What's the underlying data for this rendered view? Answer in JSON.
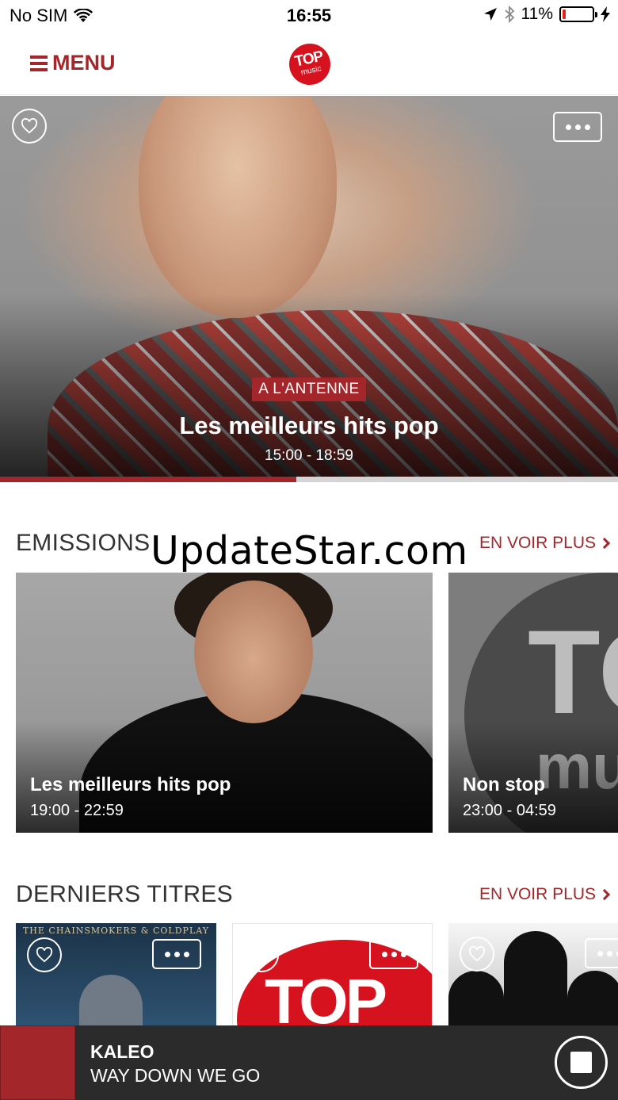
{
  "status_bar": {
    "carrier": "No SIM",
    "time": "16:55",
    "battery_percent": "11%",
    "battery_level": 0.11,
    "icons": [
      "wifi-icon",
      "location-arrow-icon",
      "bluetooth-icon",
      "battery-icon",
      "charging-bolt-icon"
    ]
  },
  "nav": {
    "menu_label": "MENU",
    "logo_line1": "TOP",
    "logo_line2": "music"
  },
  "hero": {
    "badge": "A L'ANTENNE",
    "title": "Les meilleurs hits pop",
    "time": "15:00 - 18:59",
    "progress": 0.48
  },
  "watermark": "UpdateStar.com",
  "emissions": {
    "title": "EMISSIONS",
    "see_more": "EN VOIR PLUS",
    "cards": [
      {
        "title": "Les meilleurs hits pop",
        "time": "19:00 - 22:59"
      },
      {
        "title": "Non stop",
        "time": "23:00 - 04:59",
        "art_text_1": "TO",
        "art_text_2": "mu"
      }
    ]
  },
  "derniers_titres": {
    "title": "DERNIERS TITRES",
    "see_more": "EN VOIR PLUS",
    "cards": [
      {
        "art_text": "THE CHAINSMOKERS & COLDPLAY"
      },
      {
        "art_text": "TOP"
      },
      {
        "art_text": ""
      }
    ]
  },
  "player": {
    "artist": "KALEO",
    "title": "WAY DOWN WE GO"
  },
  "colors": {
    "accent": "#a2262a",
    "logo_red": "#d7121f",
    "player_bg": "#2b2b2b"
  }
}
